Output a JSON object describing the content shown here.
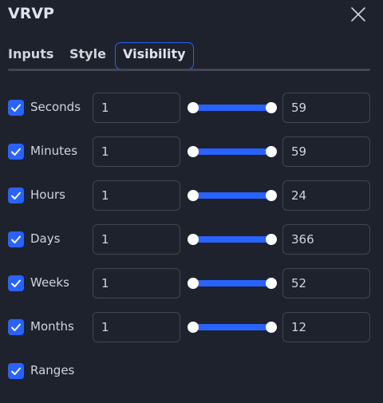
{
  "dialog": {
    "title": "VRVP"
  },
  "tabs": [
    {
      "label": "Inputs",
      "active": false
    },
    {
      "label": "Style",
      "active": false
    },
    {
      "label": "Visibility",
      "active": true
    }
  ],
  "rows": [
    {
      "label": "Seconds",
      "checked": true,
      "min": "1",
      "max": "59"
    },
    {
      "label": "Minutes",
      "checked": true,
      "min": "1",
      "max": "59"
    },
    {
      "label": "Hours",
      "checked": true,
      "min": "1",
      "max": "24"
    },
    {
      "label": "Days",
      "checked": true,
      "min": "1",
      "max": "366"
    },
    {
      "label": "Weeks",
      "checked": true,
      "min": "1",
      "max": "52"
    },
    {
      "label": "Months",
      "checked": true,
      "min": "1",
      "max": "12"
    },
    {
      "label": "Ranges",
      "checked": true
    }
  ],
  "colors": {
    "accent": "#2962ff",
    "background": "#1e222d",
    "border": "#434651",
    "text": "#d1d4dc"
  },
  "icons": {
    "close": "close-icon",
    "check": "checkmark-icon"
  }
}
